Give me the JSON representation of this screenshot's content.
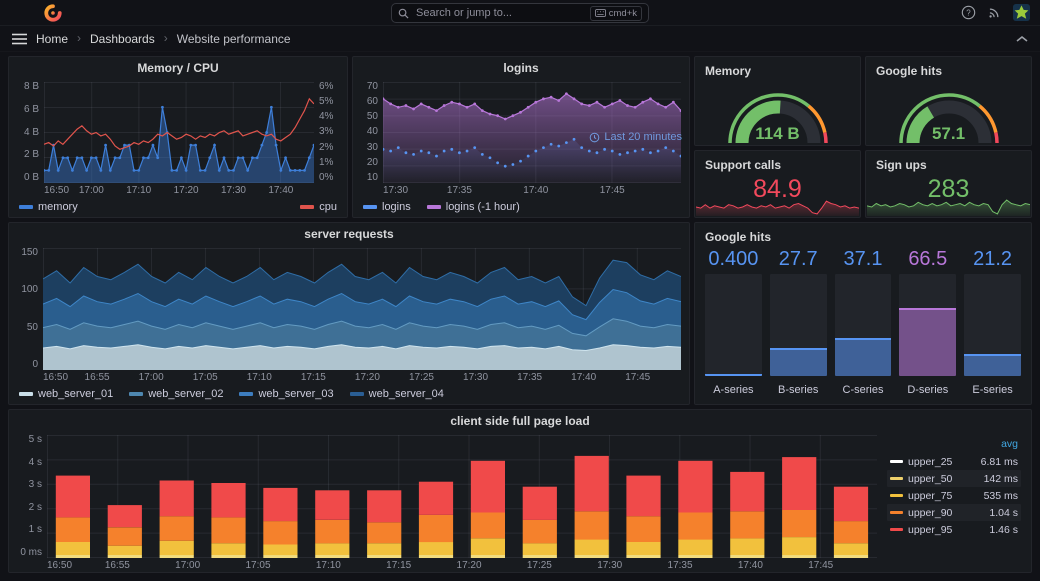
{
  "header": {
    "search_placeholder": "Search or jump to...",
    "shortcut_label": "cmd+k",
    "breadcrumbs": [
      "Home",
      "Dashboards",
      "Website performance"
    ]
  },
  "chart_data": [
    {
      "id": "memory_cpu",
      "type": "line",
      "title": "Memory / CPU",
      "x_range": [
        0,
        57
      ],
      "x_ticks": [
        {
          "v": 0,
          "l": "16:50"
        },
        {
          "v": 10,
          "l": "17:00"
        },
        {
          "v": 20,
          "l": "17:10"
        },
        {
          "v": 30,
          "l": "17:20"
        },
        {
          "v": 40,
          "l": "17:30"
        },
        {
          "v": 50,
          "l": "17:40"
        }
      ],
      "y_tick_labels": [
        "0 B",
        "2 B",
        "4 B",
        "6 B",
        "8 B"
      ],
      "y_range": [
        0,
        8
      ],
      "y_tick_labels_right": [
        "0%",
        "1%",
        "2%",
        "3%",
        "4%",
        "5%",
        "6%"
      ],
      "y_range_right": [
        0,
        6
      ],
      "legend": [
        {
          "label": "memory",
          "color": "#3E7FD9"
        },
        {
          "label": "cpu",
          "color": "#E0544C"
        }
      ],
      "series": [
        {
          "name": "memory",
          "axis": "left",
          "color": "#3E7FD9",
          "fill": "rgba(62,127,217,0.42)",
          "points": true,
          "values": [
            1,
            1,
            3,
            1,
            2,
            2,
            1,
            2,
            2,
            1,
            2,
            2,
            1,
            3,
            1,
            2,
            2,
            3,
            3,
            1,
            1,
            2,
            2,
            3,
            2,
            6,
            4,
            1,
            1,
            2,
            1,
            3,
            3,
            1,
            1,
            2,
            3,
            1,
            2,
            1,
            1,
            2,
            2,
            1,
            2,
            2,
            3,
            4,
            6,
            3,
            1,
            2,
            1,
            1,
            1,
            1,
            2,
            3
          ]
        },
        {
          "name": "cpu",
          "axis": "right",
          "color": "#E0544C",
          "values": [
            2.3,
            2.4,
            2.2,
            2.5,
            2.3,
            2.6,
            2.9,
            3.2,
            3.4,
            3.1,
            2.9,
            3.0,
            2.8,
            2.9,
            2.6,
            2.2,
            2.0,
            2.1,
            2.2,
            2.4,
            2.3,
            2.5,
            2.4,
            2.6,
            2.9,
            2.8,
            3.0,
            2.8,
            2.6,
            2.7,
            2.9,
            2.8,
            2.6,
            2.8,
            2.7,
            2.9,
            2.8,
            3.0,
            3.1,
            2.9,
            3.0,
            3.1,
            2.8,
            2.9,
            3.0,
            3.1,
            2.9,
            2.8,
            2.9,
            2.6,
            2.5,
            2.7,
            2.9,
            3.3,
            3.8,
            4.3,
            5.0,
            4.7
          ]
        }
      ]
    },
    {
      "id": "logins",
      "type": "line",
      "title": "logins",
      "time_range_label": "Last 20 minutes",
      "x_range": [
        0,
        19.5
      ],
      "x_ticks": [
        {
          "v": 0,
          "l": "17:30"
        },
        {
          "v": 5,
          "l": "17:35"
        },
        {
          "v": 10,
          "l": "17:40"
        },
        {
          "v": 15,
          "l": "17:45"
        }
      ],
      "y_tick_labels": [
        "10",
        "20",
        "30",
        "40",
        "50",
        "60",
        "70"
      ],
      "y_range": [
        10,
        70
      ],
      "legend": [
        {
          "label": "logins",
          "color": "#5794F2"
        },
        {
          "label": "logins (-1 hour)",
          "color": "#B877D9"
        }
      ],
      "series": [
        {
          "name": "logins",
          "axis": "left",
          "color": "#5794F2",
          "gradient": [
            0.16,
            0.0
          ],
          "points": true,
          "no_line": true,
          "values": [
            30,
            29,
            31,
            28,
            27,
            29,
            28,
            26,
            29,
            30,
            28,
            29,
            31,
            27,
            25,
            22,
            20,
            21,
            23,
            26,
            29,
            31,
            33,
            32,
            34,
            36,
            31,
            29,
            28,
            30,
            29,
            27,
            28,
            29,
            30,
            28,
            29,
            31,
            29,
            26
          ]
        },
        {
          "name": "logins (-1 hour)",
          "axis": "left",
          "color": "#B877D9",
          "gradient": [
            0.55,
            0.05
          ],
          "points": true,
          "values": [
            60,
            57,
            55,
            56,
            54,
            57,
            55,
            53,
            56,
            58,
            57,
            55,
            57,
            53,
            51,
            50,
            48,
            50,
            52,
            55,
            58,
            60,
            61,
            59,
            63,
            60,
            57,
            56,
            58,
            55,
            57,
            59,
            56,
            55,
            58,
            60,
            57,
            55,
            58,
            53
          ]
        }
      ]
    },
    {
      "id": "memory_gauge",
      "type": "gauge",
      "title": "Memory",
      "value": "114 B",
      "fraction": 0.52,
      "color": "#73BF69",
      "thresholds": [
        {
          "to": 72,
          "color": "#73BF69"
        },
        {
          "to": 93,
          "color": "#FF9830"
        },
        {
          "to": 100,
          "color": "#F2495C"
        }
      ]
    },
    {
      "id": "google_gauge",
      "type": "gauge",
      "title": "Google hits",
      "value": "57.1",
      "fraction": 0.33,
      "color": "#73BF69",
      "thresholds": [
        {
          "to": 72,
          "color": "#73BF69"
        },
        {
          "to": 93,
          "color": "#FF9830"
        },
        {
          "to": 100,
          "color": "#F2495C"
        }
      ]
    },
    {
      "id": "support_calls",
      "type": "stat",
      "title": "Support calls",
      "value": "84.9",
      "color": "#F2495C",
      "spark": [
        0.35,
        0.3,
        0.45,
        0.3,
        0.4,
        0.35,
        0.3,
        0.45,
        0.4,
        0.3,
        0.35,
        0.45,
        0.35,
        0.3,
        0.4,
        0.35,
        0.45,
        0.3,
        0.35,
        0.4,
        0.3,
        0.45,
        0.5,
        0.4,
        0.3,
        0.1,
        0.05,
        0.3,
        0.6,
        0.5,
        0.45,
        0.35,
        0.4,
        0.3,
        0.35,
        0.3
      ]
    },
    {
      "id": "sign_ups",
      "type": "stat",
      "title": "Sign ups",
      "value": "283",
      "color": "#73BF69",
      "spark": [
        0.4,
        0.35,
        0.5,
        0.4,
        0.45,
        0.35,
        0.4,
        0.5,
        0.45,
        0.35,
        0.4,
        0.55,
        0.45,
        0.4,
        0.5,
        0.4,
        0.45,
        0.55,
        0.4,
        0.45,
        0.5,
        0.4,
        0.55,
        0.45,
        0.4,
        0.5,
        0.45,
        0.15,
        0.05,
        0.45,
        0.65,
        0.5,
        0.45,
        0.4,
        0.5,
        0.45
      ]
    },
    {
      "id": "server_requests",
      "type": "stacked_area",
      "title": "server requests",
      "x_range": [
        0,
        59
      ],
      "x_ticks": [
        {
          "v": 0,
          "l": "16:50"
        },
        {
          "v": 5,
          "l": "16:55"
        },
        {
          "v": 10,
          "l": "17:00"
        },
        {
          "v": 15,
          "l": "17:05"
        },
        {
          "v": 20,
          "l": "17:10"
        },
        {
          "v": 25,
          "l": "17:15"
        },
        {
          "v": 30,
          "l": "17:20"
        },
        {
          "v": 35,
          "l": "17:25"
        },
        {
          "v": 40,
          "l": "17:30"
        },
        {
          "v": 45,
          "l": "17:35"
        },
        {
          "v": 50,
          "l": "17:40"
        },
        {
          "v": 55,
          "l": "17:45"
        }
      ],
      "y_tick_labels": [
        "0",
        "50",
        "100",
        "150"
      ],
      "y_range": [
        0,
        150
      ],
      "legend": [
        {
          "label": "web_server_01",
          "color": "#C9DEE8"
        },
        {
          "label": "web_server_02",
          "color": "#4E87B0"
        },
        {
          "label": "web_server_03",
          "color": "#3D7DBF"
        },
        {
          "label": "web_server_04",
          "color": "#2A5E94"
        }
      ],
      "series": [
        {
          "name": "web_server_01",
          "fill": "#AFC4CF",
          "line": "#CFE4EE",
          "values": [
            27,
            29,
            26,
            30,
            28,
            27,
            29,
            31,
            28,
            26,
            29,
            27,
            30,
            28,
            26,
            28,
            30,
            27,
            29,
            28,
            26,
            29,
            31,
            28,
            27,
            29,
            26,
            30,
            28,
            27,
            29,
            28,
            26,
            29,
            30,
            27,
            28,
            26,
            29,
            25,
            24,
            27,
            31,
            30,
            28,
            27,
            29,
            28
          ]
        },
        {
          "name": "web_server_02",
          "fill": "#3F7096",
          "line": "#639BC2",
          "values": [
            25,
            27,
            24,
            28,
            26,
            25,
            27,
            29,
            26,
            24,
            27,
            25,
            28,
            26,
            24,
            26,
            28,
            25,
            27,
            26,
            24,
            27,
            29,
            26,
            25,
            27,
            24,
            28,
            26,
            25,
            27,
            26,
            24,
            27,
            28,
            25,
            26,
            24,
            26,
            20,
            18,
            26,
            32,
            30,
            26,
            25,
            27,
            26
          ]
        },
        {
          "name": "web_server_03",
          "fill": "#2A5E8E",
          "line": "#3E86C8",
          "values": [
            29,
            32,
            28,
            33,
            30,
            29,
            31,
            34,
            30,
            28,
            31,
            29,
            33,
            30,
            28,
            30,
            33,
            29,
            31,
            30,
            28,
            31,
            34,
            30,
            29,
            31,
            28,
            33,
            30,
            29,
            31,
            30,
            28,
            31,
            33,
            29,
            30,
            28,
            30,
            23,
            20,
            30,
            36,
            35,
            31,
            29,
            32,
            30
          ]
        },
        {
          "name": "web_server_04",
          "fill": "#1D3F60",
          "line": "#2F6DA6",
          "values": [
            31,
            34,
            29,
            35,
            31,
            30,
            33,
            36,
            31,
            29,
            33,
            30,
            35,
            31,
            29,
            31,
            35,
            30,
            33,
            31,
            29,
            33,
            36,
            31,
            30,
            33,
            29,
            35,
            31,
            30,
            33,
            31,
            29,
            33,
            35,
            30,
            31,
            29,
            30,
            22,
            17,
            30,
            36,
            37,
            32,
            30,
            34,
            31
          ]
        }
      ]
    },
    {
      "id": "google_hits_bars",
      "type": "bar_gauge",
      "title": "Google hits",
      "max": 100,
      "bars": [
        {
          "label": "A-series",
          "display": "0.400",
          "value": 0.4,
          "color": "#5794F2"
        },
        {
          "label": "B-series",
          "display": "27.7",
          "value": 27.7,
          "color": "#5794F2"
        },
        {
          "label": "C-series",
          "display": "37.1",
          "value": 37.1,
          "color": "#5794F2"
        },
        {
          "label": "D-series",
          "display": "66.5",
          "value": 66.5,
          "color": "#B877D9"
        },
        {
          "label": "E-series",
          "display": "21.2",
          "value": 21.2,
          "color": "#5794F2"
        }
      ]
    },
    {
      "id": "page_load",
      "type": "stacked_bar",
      "title": "client side full page load",
      "x_range": [
        0,
        59
      ],
      "x_ticks": [
        {
          "v": 0,
          "l": "16:50"
        },
        {
          "v": 5,
          "l": "16:55"
        },
        {
          "v": 10,
          "l": "17:00"
        },
        {
          "v": 15,
          "l": "17:05"
        },
        {
          "v": 20,
          "l": "17:10"
        },
        {
          "v": 25,
          "l": "17:15"
        },
        {
          "v": 30,
          "l": "17:20"
        },
        {
          "v": 35,
          "l": "17:25"
        },
        {
          "v": 40,
          "l": "17:30"
        },
        {
          "v": 45,
          "l": "17:35"
        },
        {
          "v": 50,
          "l": "17:40"
        },
        {
          "v": 55,
          "l": "17:45"
        }
      ],
      "y_tick_labels": [
        "0 ms",
        "1 s",
        "2 s",
        "3 s",
        "4 s",
        "5 s"
      ],
      "y_range": [
        0,
        5
      ],
      "series": [
        {
          "name": "upper_50",
          "color": "#F2DC7E",
          "tops": [
            0.12,
            0.12,
            0.12,
            0.12,
            0.12,
            0.12,
            0.12,
            0.12,
            0.12,
            0.12,
            0.12,
            0.12,
            0.12,
            0.12,
            0.12,
            0.12
          ]
        },
        {
          "name": "upper_75",
          "color": "#F2C13D",
          "tops": [
            0.65,
            0.5,
            0.7,
            0.6,
            0.55,
            0.6,
            0.6,
            0.65,
            0.8,
            0.6,
            0.75,
            0.65,
            0.75,
            0.8,
            0.85,
            0.6
          ]
        },
        {
          "name": "upper_90",
          "color": "#F5812C",
          "tops": [
            1.65,
            1.25,
            1.7,
            1.65,
            1.5,
            1.55,
            1.45,
            1.75,
            1.85,
            1.55,
            1.9,
            1.7,
            1.85,
            1.9,
            1.95,
            1.5
          ]
        },
        {
          "name": "upper_95",
          "color": "#F04A4A",
          "tops": [
            3.35,
            2.15,
            3.15,
            3.05,
            2.85,
            2.75,
            2.75,
            3.1,
            3.95,
            2.9,
            4.15,
            3.35,
            3.95,
            3.5,
            4.1,
            2.9
          ]
        }
      ],
      "legend_header": "avg",
      "legend_rows": [
        {
          "label": "upper_25",
          "color": "#FFFFFF",
          "value": "6.81 ms"
        },
        {
          "label": "upper_50",
          "color": "#EFD16C",
          "value": "142 ms"
        },
        {
          "label": "upper_75",
          "color": "#F2C13D",
          "value": "535 ms"
        },
        {
          "label": "upper_90",
          "color": "#F5812C",
          "value": "1.04 s"
        },
        {
          "label": "upper_95",
          "color": "#F04A4A",
          "value": "1.46 s"
        }
      ]
    }
  ]
}
